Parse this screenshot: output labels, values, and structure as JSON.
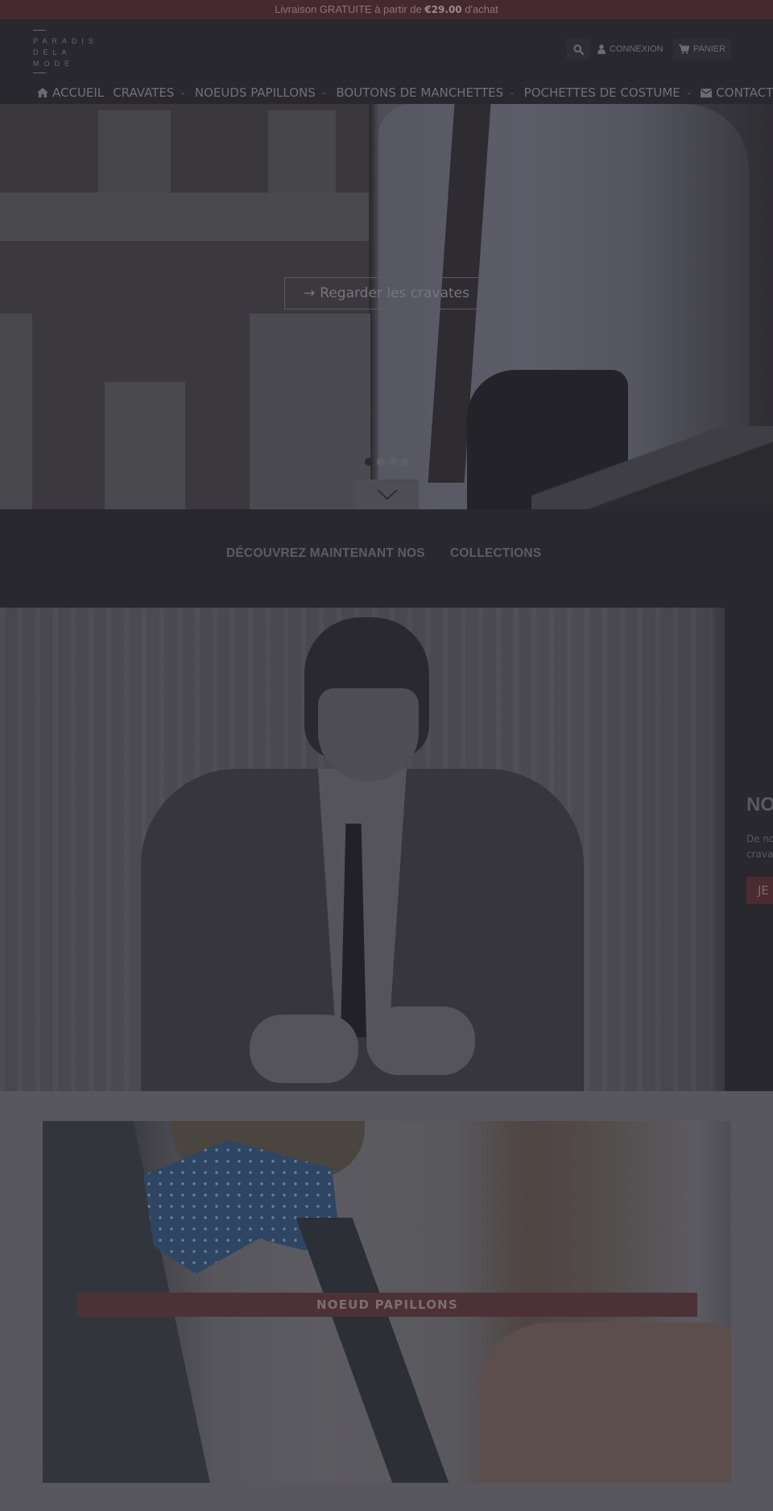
{
  "announcement": {
    "prefix": "Livraison GRATUITE à partir de ",
    "amount": "€29.00",
    "suffix": " d'achat"
  },
  "logo": {
    "lines": [
      "PARADIS",
      "DELA",
      "MODE"
    ]
  },
  "header_tools": {
    "search_icon": "search-icon",
    "login_label": "CONNEXION",
    "cart_label": "PANIER"
  },
  "nav": {
    "items": [
      {
        "label": "ACCUEIL",
        "icon": "home-icon",
        "dropdown": false
      },
      {
        "label": "CRAVATES",
        "dropdown": true
      },
      {
        "label": "NOEUDS PAPILLONS",
        "dropdown": true
      },
      {
        "label": "BOUTONS DE MANCHETTES",
        "dropdown": true
      },
      {
        "label": "POCHETTES DE COSTUME",
        "dropdown": true
      },
      {
        "label": "CONTACTEZ",
        "icon": "envelope-icon",
        "dropdown": false
      }
    ]
  },
  "hero": {
    "cta_label": "Regarder les cravates",
    "cta_icon": "arrow-right-icon",
    "slides_total": 4,
    "active_slide": 1,
    "scroll_icon": "chevron-down-icon"
  },
  "collections": {
    "heading_part1": "DÉCOUVREZ MAINTENANT NOS",
    "heading_part2": "COLLECTIONS"
  },
  "feature": {
    "title": "NO",
    "description": "De no\ncrava",
    "button_label": "JE"
  },
  "category": {
    "label": "NOEUD PAPILLONS"
  },
  "colors": {
    "announcement_bg": "#46292e",
    "header_bg": "#29282e",
    "accent": "#4a2b30",
    "category_section_bg": "#58575d"
  }
}
